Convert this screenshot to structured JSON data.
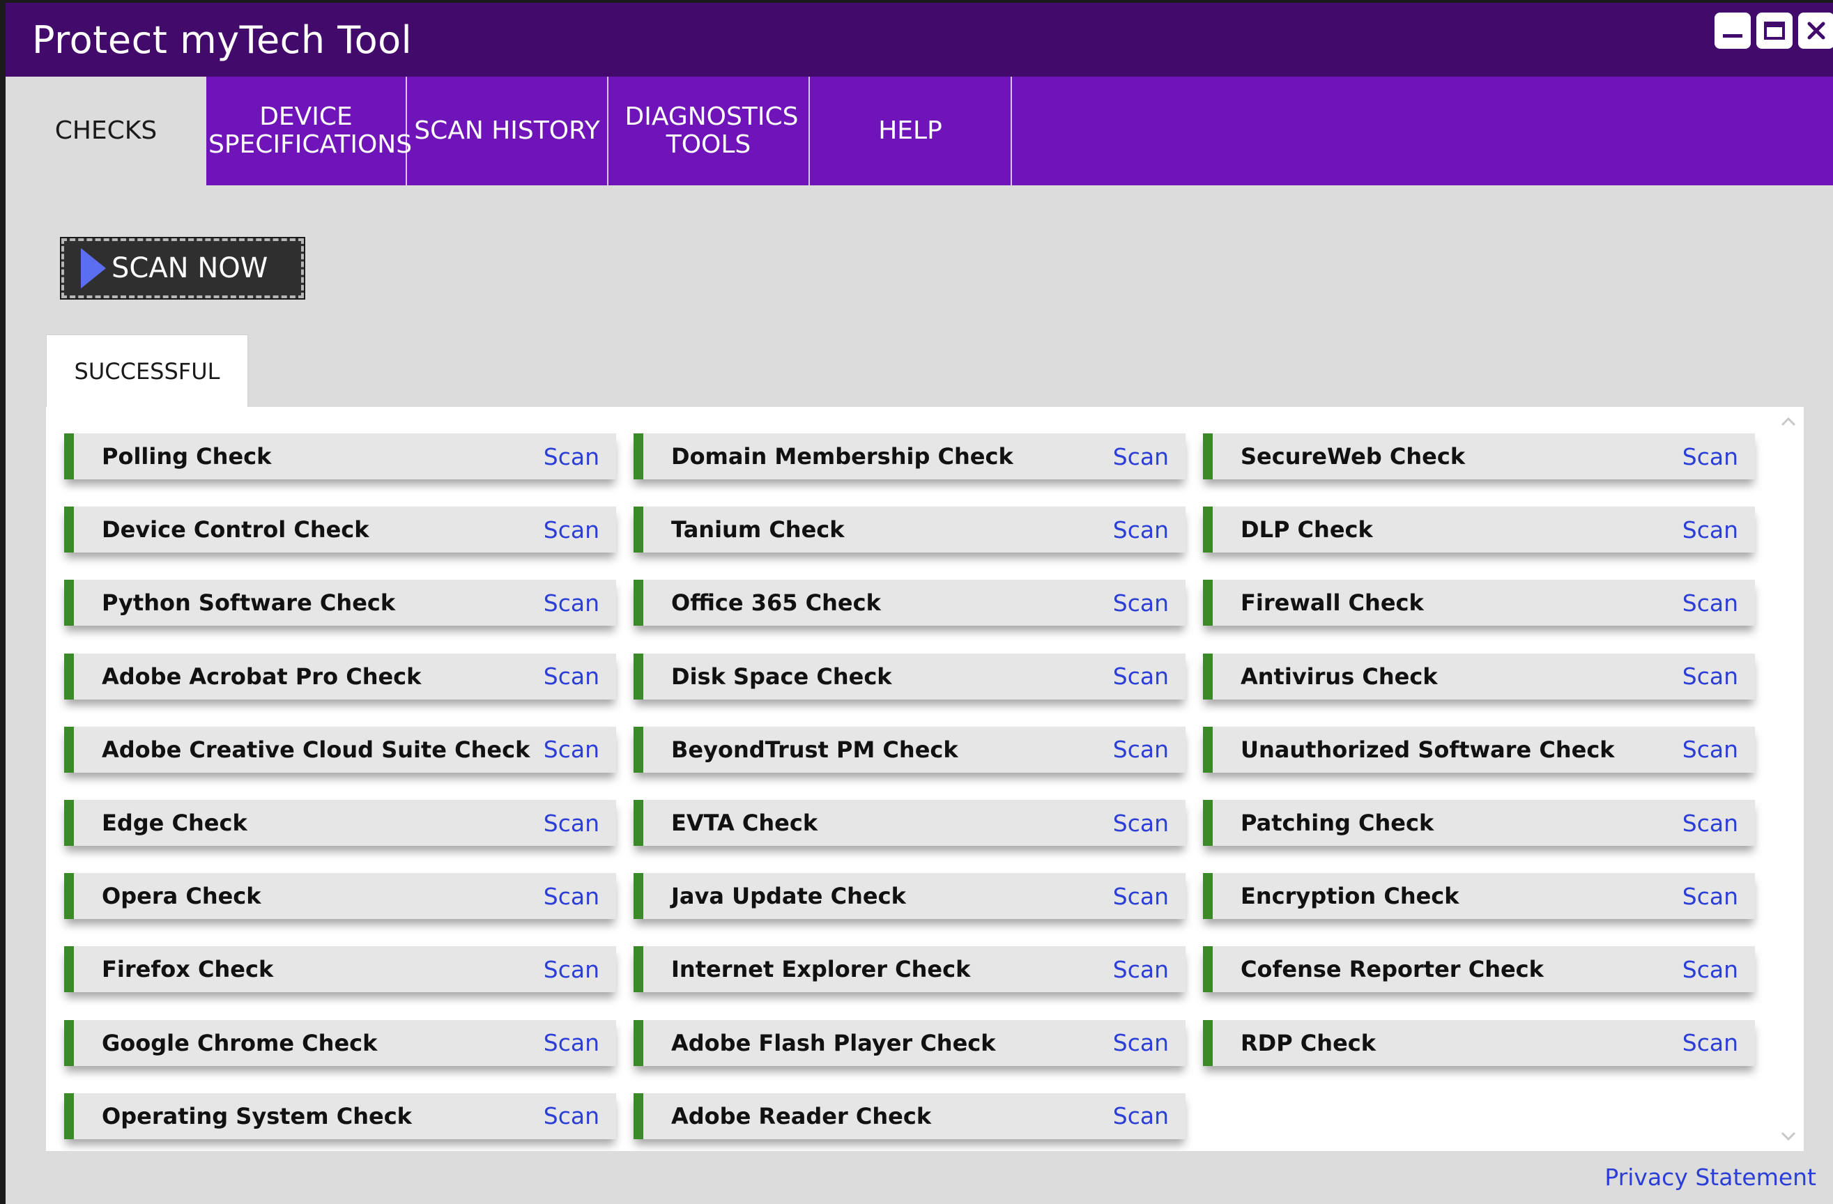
{
  "window": {
    "title": "Protect myTech Tool"
  },
  "tabs": [
    {
      "label": "CHECKS"
    },
    {
      "label": "DEVICE SPECIFICATIONS"
    },
    {
      "label": "SCAN HISTORY"
    },
    {
      "label": "DIAGNOSTICS TOOLS"
    },
    {
      "label": "HELP"
    }
  ],
  "scan_now": {
    "label": "SCAN NOW"
  },
  "results": {
    "tab_label": "SUCCESSFUL",
    "action_label": "Scan",
    "columns": [
      [
        "Polling Check",
        "Device Control Check",
        "Python Software Check",
        "Adobe Acrobat Pro Check",
        "Adobe Creative Cloud Suite Check",
        "Edge Check",
        "Opera Check",
        "Firefox Check",
        "Google Chrome Check",
        "Operating System Check"
      ],
      [
        "Domain Membership Check",
        "Tanium Check",
        "Office 365 Check",
        "Disk Space Check",
        "BeyondTrust PM Check",
        "EVTA Check",
        "Java Update Check",
        "Internet Explorer Check",
        "Adobe Flash Player Check",
        "Adobe Reader Check"
      ],
      [
        "SecureWeb Check",
        "DLP Check",
        "Firewall Check",
        "Antivirus Check",
        "Unauthorized Software Check",
        "Patching Check",
        "Encryption Check",
        "Cofense Reporter Check",
        "RDP Check"
      ]
    ]
  },
  "footer": {
    "privacy_label": "Privacy Statement"
  },
  "colors": {
    "titlebar": "#410a6b",
    "tabsbar": "#6f14b9",
    "status_success": "#3a8a2a",
    "link": "#2b3fd6",
    "play_accent": "#5b6df0"
  },
  "icons": {
    "minimize": "minimize-icon",
    "maximize": "maximize-icon",
    "close": "close-icon",
    "play": "play-icon",
    "scroll_up": "chevron-up-icon",
    "scroll_down": "chevron-down-icon"
  }
}
